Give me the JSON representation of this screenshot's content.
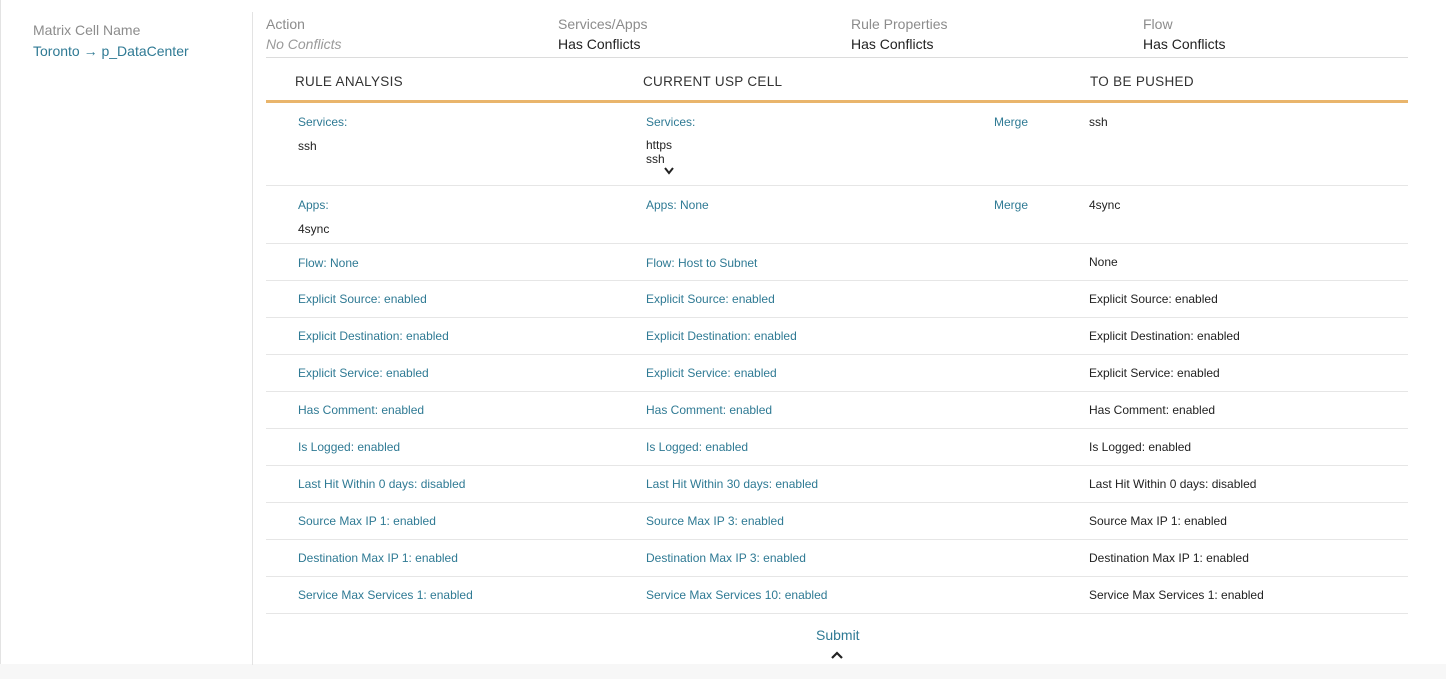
{
  "matrix": {
    "label": "Matrix Cell Name",
    "value": "Toronto → p_DataCenter"
  },
  "summary": [
    {
      "label": "Action",
      "value": "No Conflicts",
      "muted": true
    },
    {
      "label": "Services/Apps",
      "value": "Has Conflicts",
      "muted": false
    },
    {
      "label": "Rule Properties",
      "value": "Has Conflicts",
      "muted": false
    },
    {
      "label": "Flow",
      "value": "Has Conflicts",
      "muted": false
    }
  ],
  "table": {
    "headers": {
      "analysis": "RULE ANALYSIS",
      "current": "CURRENT USP CELL",
      "pushed": "TO BE PUSHED"
    },
    "services": {
      "analysis_label": "Services:",
      "analysis_value": "ssh",
      "current_label": "Services:",
      "current_values": [
        "https",
        "ssh"
      ],
      "merge": "Merge",
      "pushed": "ssh"
    },
    "apps": {
      "analysis_label": "Apps:",
      "analysis_value": "4sync",
      "current": "Apps: None",
      "merge": "Merge",
      "pushed": "4sync"
    },
    "rows": [
      {
        "analysis": "Flow: None",
        "current": "Flow: Host to Subnet",
        "pushed": "None"
      },
      {
        "analysis": "Explicit Source: enabled",
        "current": "Explicit Source: enabled",
        "pushed": "Explicit Source: enabled"
      },
      {
        "analysis": "Explicit Destination: enabled",
        "current": "Explicit Destination: enabled",
        "pushed": "Explicit Destination: enabled"
      },
      {
        "analysis": "Explicit Service: enabled",
        "current": "Explicit Service: enabled",
        "pushed": "Explicit Service: enabled"
      },
      {
        "analysis": "Has Comment: enabled",
        "current": "Has Comment: enabled",
        "pushed": "Has Comment: enabled"
      },
      {
        "analysis": "Is Logged: enabled",
        "current": "Is Logged: enabled",
        "pushed": "Is Logged: enabled"
      },
      {
        "analysis": "Last Hit Within 0 days: disabled",
        "current": "Last Hit Within 30 days: enabled",
        "pushed": "Last Hit Within 0 days: disabled"
      },
      {
        "analysis": "Source Max IP 1: enabled",
        "current": "Source Max IP 3: enabled",
        "pushed": "Source Max IP 1: enabled"
      },
      {
        "analysis": "Destination Max IP 1: enabled",
        "current": "Destination Max IP 3: enabled",
        "pushed": "Destination Max IP 1: enabled"
      },
      {
        "analysis": "Service Max Services 1: enabled",
        "current": "Service Max Services 10: enabled",
        "pushed": "Service Max Services 1: enabled"
      }
    ]
  },
  "submit_label": "Submit",
  "icons": {
    "expand": "chevron-down-icon",
    "collapse": "chevron-up-icon"
  },
  "colors": {
    "link": "#2f7a94",
    "accent_border": "#e9b56c",
    "muted_text": "#8c8c8c"
  }
}
